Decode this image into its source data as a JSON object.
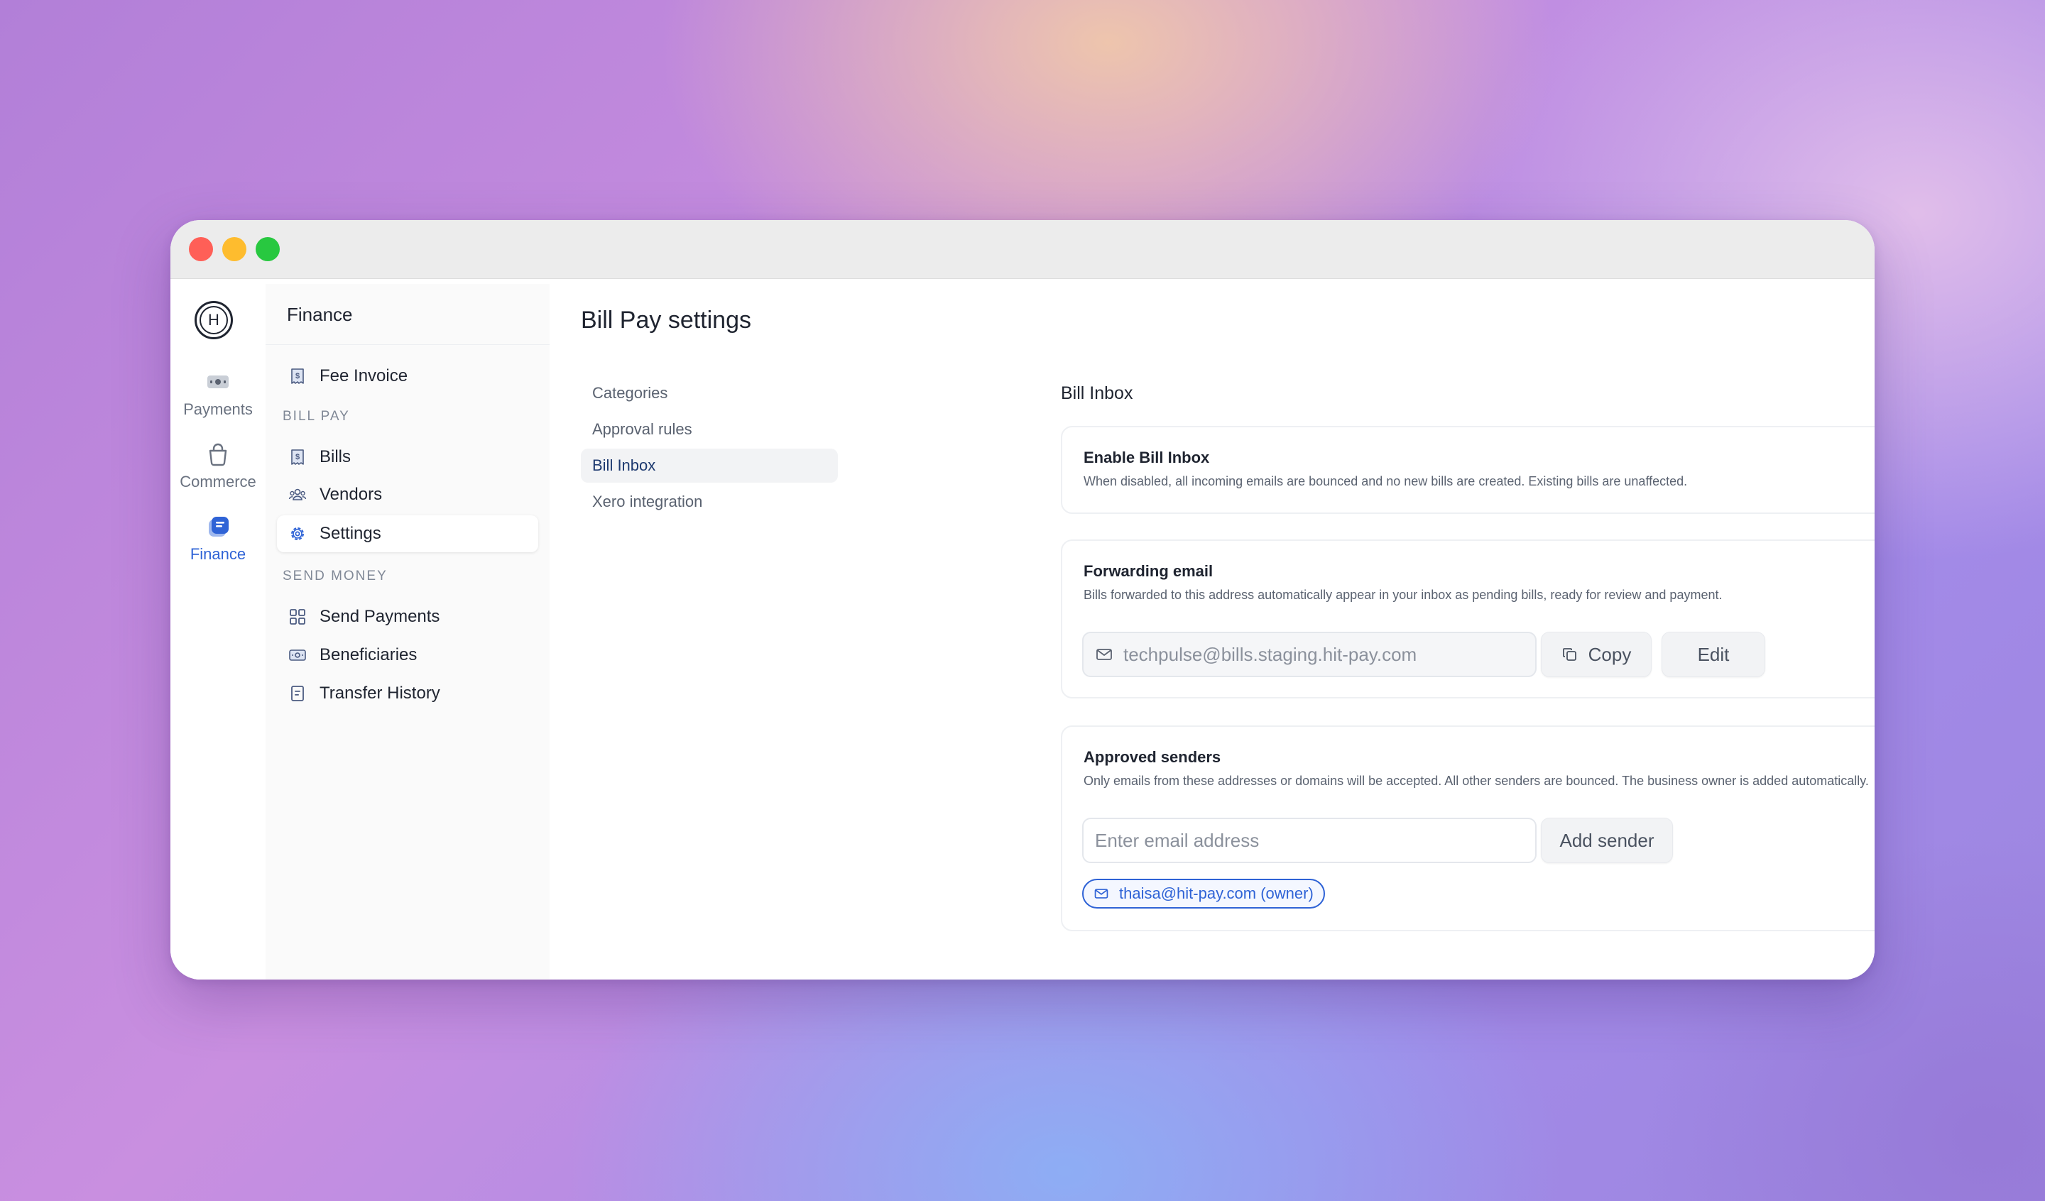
{
  "rail": {
    "logo_letter": "H",
    "items": [
      {
        "label": "Payments",
        "icon": "payments-icon"
      },
      {
        "label": "Commerce",
        "icon": "shopping-bag-icon"
      },
      {
        "label": "Finance",
        "icon": "finance-icon"
      }
    ],
    "active": "Finance"
  },
  "sidebar": {
    "title": "Finance",
    "fee_invoice": "Fee Invoice",
    "bill_pay_section": "BILL PAY",
    "bills": "Bills",
    "vendors": "Vendors",
    "settings": "Settings",
    "send_money_section": "SEND MONEY",
    "send_payments": "Send Payments",
    "beneficiaries": "Beneficiaries",
    "transfer_history": "Transfer History"
  },
  "main": {
    "page_title": "Bill Pay settings",
    "subnav": [
      "Categories",
      "Approval rules",
      "Bill Inbox",
      "Xero integration"
    ],
    "subnav_active": "Bill Inbox",
    "section_title": "Bill Inbox",
    "enable": {
      "title": "Enable Bill Inbox",
      "description": "When disabled, all incoming emails are bounced and no new bills are created. Existing bills are unaffected.",
      "enabled": true
    },
    "forwarding": {
      "title": "Forwarding email",
      "description": "Bills forwarded to this address automatically appear in your inbox as pending bills, ready for review and payment.",
      "email": "techpulse@bills.staging.hit-pay.com",
      "copy_label": "Copy",
      "edit_label": "Edit"
    },
    "approved": {
      "title": "Approved senders",
      "description": "Only emails from these addresses or domains will be accepted. All other senders are bounced. The business owner is added automatically.",
      "input_placeholder": "Enter email address",
      "add_label": "Add sender",
      "senders": [
        "thaisa@hit-pay.com (owner)"
      ]
    }
  },
  "colors": {
    "accent": "#2f63d6",
    "text": "#1f2430",
    "muted": "#5a6270"
  }
}
